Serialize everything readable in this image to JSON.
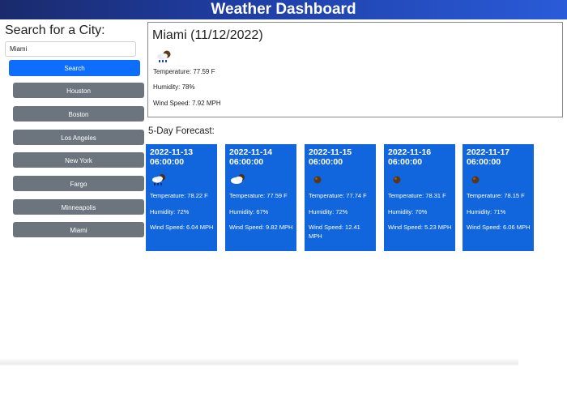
{
  "header": {
    "title": "Weather Dashboard"
  },
  "sidebar": {
    "heading": "Search for a City:",
    "search_value": "Miami",
    "search_label": "Search",
    "cities": [
      "Houston",
      "Boston",
      "Los Angeles",
      "New York",
      "Fargo",
      "Minneapolis",
      "Miami"
    ]
  },
  "current": {
    "title": "Miami (11/12/2022)",
    "icon": "night-cloudy-rain-icon",
    "temperature": "Temperature: 77.59 F",
    "humidity": "Humidity: 78%",
    "wind": "Wind Speed: 7.92 MPH"
  },
  "forecast": {
    "title": "5-Day Forecast:",
    "days": [
      {
        "date": "2022-11-13 06:00:00",
        "icon": "night-cloud-rain-icon",
        "temperature": "Temperature: 78.22 F",
        "humidity": "Humidity: 72%",
        "wind": "Wind Speed: 6.04 MPH"
      },
      {
        "date": "2022-11-14 06:00:00",
        "icon": "night-cloud-icon",
        "temperature": "Temperature: 77.59 F",
        "humidity": "Humidity: 67%",
        "wind": "Wind Speed: 9.82 MPH"
      },
      {
        "date": "2022-11-15 06:00:00",
        "icon": "clear-night-icon",
        "temperature": "Temperature: 77.74 F",
        "humidity": "Humidity: 72%",
        "wind": "Wind Speed: 12.41 MPH"
      },
      {
        "date": "2022-11-16 06:00:00",
        "icon": "clear-night-icon",
        "temperature": "Temperature: 78.31 F",
        "humidity": "Humidity: 70%",
        "wind": "Wind Speed: 5.23 MPH"
      },
      {
        "date": "2022-11-17 06:00:00",
        "icon": "clear-night-icon",
        "temperature": "Temperature: 78.15 F",
        "humidity": "Humidity: 71%",
        "wind": "Wind Speed: 6.06 MPH"
      }
    ]
  },
  "colors": {
    "card": "#1166dd",
    "search_button": "#0d6efd",
    "city_button": "#6c757d"
  }
}
